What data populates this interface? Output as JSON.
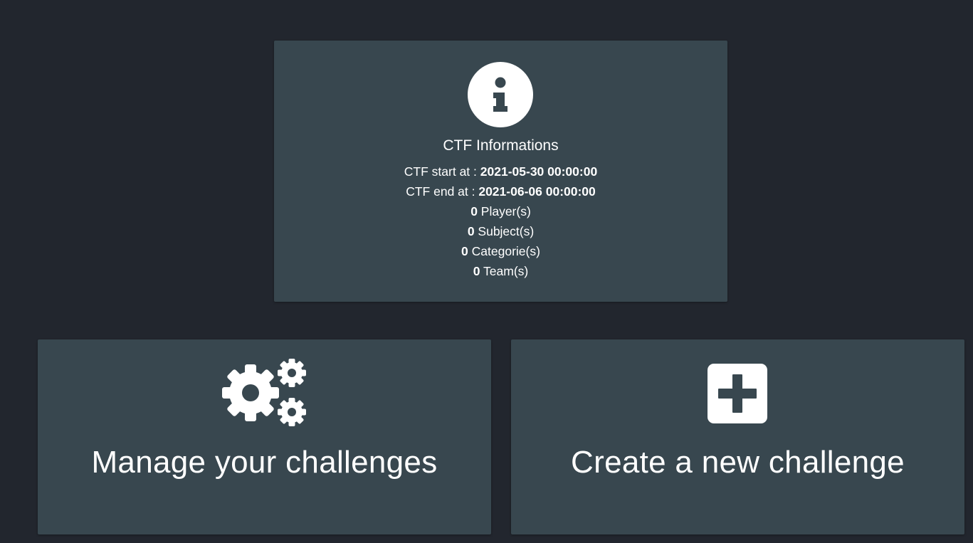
{
  "info": {
    "icon": "info-circle-icon",
    "title": "CTF Informations",
    "start_label": "CTF start at : ",
    "start_value": "2021-05-30 00:00:00",
    "end_label": "CTF end at : ",
    "end_value": "2021-06-06 00:00:00",
    "players_count": "0",
    "players_label": " Player(s)",
    "subjects_count": "0",
    "subjects_label": " Subject(s)",
    "categories_count": "0",
    "categories_label": " Categorie(s)",
    "teams_count": "0",
    "teams_label": " Team(s)"
  },
  "actions": {
    "manage": {
      "icon": "cogs-icon",
      "label": "Manage your challenges"
    },
    "create": {
      "icon": "plus-square-icon",
      "label": "Create a new challenge"
    }
  },
  "colors": {
    "background": "#22262e",
    "card": "#38474f",
    "text": "#ffffff"
  }
}
